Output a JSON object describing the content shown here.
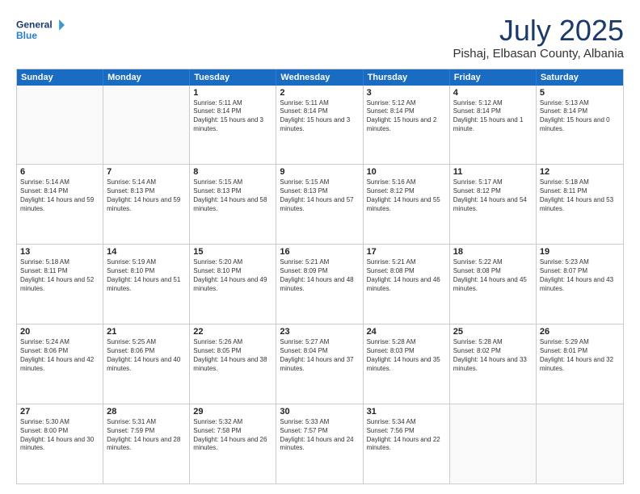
{
  "logo": {
    "line1": "General",
    "line2": "Blue"
  },
  "title": "July 2025",
  "location": "Pishaj, Elbasan County, Albania",
  "days_header": [
    "Sunday",
    "Monday",
    "Tuesday",
    "Wednesday",
    "Thursday",
    "Friday",
    "Saturday"
  ],
  "weeks": [
    [
      {
        "day": "",
        "sunrise": "",
        "sunset": "",
        "daylight": ""
      },
      {
        "day": "",
        "sunrise": "",
        "sunset": "",
        "daylight": ""
      },
      {
        "day": "1",
        "sunrise": "Sunrise: 5:11 AM",
        "sunset": "Sunset: 8:14 PM",
        "daylight": "Daylight: 15 hours and 3 minutes."
      },
      {
        "day": "2",
        "sunrise": "Sunrise: 5:11 AM",
        "sunset": "Sunset: 8:14 PM",
        "daylight": "Daylight: 15 hours and 3 minutes."
      },
      {
        "day": "3",
        "sunrise": "Sunrise: 5:12 AM",
        "sunset": "Sunset: 8:14 PM",
        "daylight": "Daylight: 15 hours and 2 minutes."
      },
      {
        "day": "4",
        "sunrise": "Sunrise: 5:12 AM",
        "sunset": "Sunset: 8:14 PM",
        "daylight": "Daylight: 15 hours and 1 minute."
      },
      {
        "day": "5",
        "sunrise": "Sunrise: 5:13 AM",
        "sunset": "Sunset: 8:14 PM",
        "daylight": "Daylight: 15 hours and 0 minutes."
      }
    ],
    [
      {
        "day": "6",
        "sunrise": "Sunrise: 5:14 AM",
        "sunset": "Sunset: 8:14 PM",
        "daylight": "Daylight: 14 hours and 59 minutes."
      },
      {
        "day": "7",
        "sunrise": "Sunrise: 5:14 AM",
        "sunset": "Sunset: 8:13 PM",
        "daylight": "Daylight: 14 hours and 59 minutes."
      },
      {
        "day": "8",
        "sunrise": "Sunrise: 5:15 AM",
        "sunset": "Sunset: 8:13 PM",
        "daylight": "Daylight: 14 hours and 58 minutes."
      },
      {
        "day": "9",
        "sunrise": "Sunrise: 5:15 AM",
        "sunset": "Sunset: 8:13 PM",
        "daylight": "Daylight: 14 hours and 57 minutes."
      },
      {
        "day": "10",
        "sunrise": "Sunrise: 5:16 AM",
        "sunset": "Sunset: 8:12 PM",
        "daylight": "Daylight: 14 hours and 55 minutes."
      },
      {
        "day": "11",
        "sunrise": "Sunrise: 5:17 AM",
        "sunset": "Sunset: 8:12 PM",
        "daylight": "Daylight: 14 hours and 54 minutes."
      },
      {
        "day": "12",
        "sunrise": "Sunrise: 5:18 AM",
        "sunset": "Sunset: 8:11 PM",
        "daylight": "Daylight: 14 hours and 53 minutes."
      }
    ],
    [
      {
        "day": "13",
        "sunrise": "Sunrise: 5:18 AM",
        "sunset": "Sunset: 8:11 PM",
        "daylight": "Daylight: 14 hours and 52 minutes."
      },
      {
        "day": "14",
        "sunrise": "Sunrise: 5:19 AM",
        "sunset": "Sunset: 8:10 PM",
        "daylight": "Daylight: 14 hours and 51 minutes."
      },
      {
        "day": "15",
        "sunrise": "Sunrise: 5:20 AM",
        "sunset": "Sunset: 8:10 PM",
        "daylight": "Daylight: 14 hours and 49 minutes."
      },
      {
        "day": "16",
        "sunrise": "Sunrise: 5:21 AM",
        "sunset": "Sunset: 8:09 PM",
        "daylight": "Daylight: 14 hours and 48 minutes."
      },
      {
        "day": "17",
        "sunrise": "Sunrise: 5:21 AM",
        "sunset": "Sunset: 8:08 PM",
        "daylight": "Daylight: 14 hours and 46 minutes."
      },
      {
        "day": "18",
        "sunrise": "Sunrise: 5:22 AM",
        "sunset": "Sunset: 8:08 PM",
        "daylight": "Daylight: 14 hours and 45 minutes."
      },
      {
        "day": "19",
        "sunrise": "Sunrise: 5:23 AM",
        "sunset": "Sunset: 8:07 PM",
        "daylight": "Daylight: 14 hours and 43 minutes."
      }
    ],
    [
      {
        "day": "20",
        "sunrise": "Sunrise: 5:24 AM",
        "sunset": "Sunset: 8:06 PM",
        "daylight": "Daylight: 14 hours and 42 minutes."
      },
      {
        "day": "21",
        "sunrise": "Sunrise: 5:25 AM",
        "sunset": "Sunset: 8:06 PM",
        "daylight": "Daylight: 14 hours and 40 minutes."
      },
      {
        "day": "22",
        "sunrise": "Sunrise: 5:26 AM",
        "sunset": "Sunset: 8:05 PM",
        "daylight": "Daylight: 14 hours and 38 minutes."
      },
      {
        "day": "23",
        "sunrise": "Sunrise: 5:27 AM",
        "sunset": "Sunset: 8:04 PM",
        "daylight": "Daylight: 14 hours and 37 minutes."
      },
      {
        "day": "24",
        "sunrise": "Sunrise: 5:28 AM",
        "sunset": "Sunset: 8:03 PM",
        "daylight": "Daylight: 14 hours and 35 minutes."
      },
      {
        "day": "25",
        "sunrise": "Sunrise: 5:28 AM",
        "sunset": "Sunset: 8:02 PM",
        "daylight": "Daylight: 14 hours and 33 minutes."
      },
      {
        "day": "26",
        "sunrise": "Sunrise: 5:29 AM",
        "sunset": "Sunset: 8:01 PM",
        "daylight": "Daylight: 14 hours and 32 minutes."
      }
    ],
    [
      {
        "day": "27",
        "sunrise": "Sunrise: 5:30 AM",
        "sunset": "Sunset: 8:00 PM",
        "daylight": "Daylight: 14 hours and 30 minutes."
      },
      {
        "day": "28",
        "sunrise": "Sunrise: 5:31 AM",
        "sunset": "Sunset: 7:59 PM",
        "daylight": "Daylight: 14 hours and 28 minutes."
      },
      {
        "day": "29",
        "sunrise": "Sunrise: 5:32 AM",
        "sunset": "Sunset: 7:58 PM",
        "daylight": "Daylight: 14 hours and 26 minutes."
      },
      {
        "day": "30",
        "sunrise": "Sunrise: 5:33 AM",
        "sunset": "Sunset: 7:57 PM",
        "daylight": "Daylight: 14 hours and 24 minutes."
      },
      {
        "day": "31",
        "sunrise": "Sunrise: 5:34 AM",
        "sunset": "Sunset: 7:56 PM",
        "daylight": "Daylight: 14 hours and 22 minutes."
      },
      {
        "day": "",
        "sunrise": "",
        "sunset": "",
        "daylight": ""
      },
      {
        "day": "",
        "sunrise": "",
        "sunset": "",
        "daylight": ""
      }
    ]
  ]
}
